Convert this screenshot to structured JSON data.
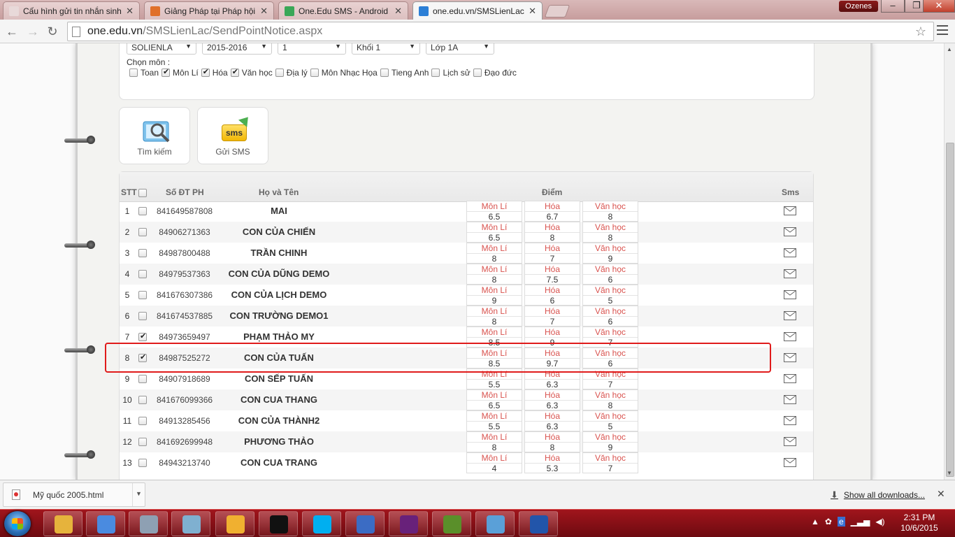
{
  "browser": {
    "tabs": [
      {
        "label": "Cấu hình gửi tin nhắn sinh",
        "icon": "page-icon",
        "color": "#e8d9d9"
      },
      {
        "label": "Giảng Pháp tại Pháp hội q",
        "icon": "lotus-icon",
        "color": "#e0702a"
      },
      {
        "label": "One.Edu SMS - Android A",
        "icon": "play-store-icon",
        "color": "#3aa757"
      },
      {
        "label": "one.edu.vn/SMSLienLac/S",
        "icon": "site-icon",
        "color": "#2c7fd6"
      }
    ],
    "profile": "Ozenes",
    "url_host": "one.edu.vn",
    "url_path": "/SMSLienLac/SendPointNotice.aspx"
  },
  "filters": {
    "selects": [
      "SOLIENLA",
      "2015-2016",
      "1",
      "Khối 1",
      "Lớp 1A"
    ],
    "chon_mon_label": "Chọn môn :",
    "subjects": [
      {
        "label": "Toan",
        "checked": false
      },
      {
        "label": "Môn Lí",
        "checked": true
      },
      {
        "label": "Hóa",
        "checked": true
      },
      {
        "label": "Văn học",
        "checked": true
      },
      {
        "label": "Địa lý",
        "checked": false
      },
      {
        "label": "Môn Nhạc Họa",
        "checked": false
      },
      {
        "label": "Tieng Anh",
        "checked": false
      },
      {
        "label": "Lịch sử",
        "checked": false
      },
      {
        "label": "Đạo đức",
        "checked": false
      }
    ]
  },
  "actions": {
    "search_label": "Tìm kiếm",
    "sms_label": "Gửi SMS",
    "sms_icon_text": "sms"
  },
  "table": {
    "headers": {
      "stt": "STT",
      "phone": "Số ĐT PH",
      "name": "Họ và Tên",
      "score": "Điểm",
      "sms": "Sms"
    },
    "score_subjects": [
      "Môn Lí",
      "Hóa",
      "Văn học"
    ],
    "rows": [
      {
        "stt": "1",
        "checked": false,
        "phone": "841649587808",
        "name": "MAI",
        "scores": [
          "6.5",
          "6.7",
          "8"
        ]
      },
      {
        "stt": "2",
        "checked": false,
        "phone": "84906271363",
        "name": "CON CỦA CHIẾN",
        "scores": [
          "6.5",
          "8",
          "8"
        ]
      },
      {
        "stt": "3",
        "checked": false,
        "phone": "84987800488",
        "name": "TRẦN CHINH",
        "scores": [
          "8",
          "7",
          "9"
        ]
      },
      {
        "stt": "4",
        "checked": false,
        "phone": "84979537363",
        "name": "CON CỦA DŨNG DEMO",
        "scores": [
          "8",
          "7.5",
          "6"
        ]
      },
      {
        "stt": "5",
        "checked": false,
        "phone": "841676307386",
        "name": "CON CỦA LỊCH DEMO",
        "scores": [
          "9",
          "6",
          "5"
        ]
      },
      {
        "stt": "6",
        "checked": false,
        "phone": "841674537885",
        "name": "CON TRƯỜNG DEMO1",
        "scores": [
          "8",
          "7",
          "6"
        ]
      },
      {
        "stt": "7",
        "checked": true,
        "phone": "84973659497",
        "name": "PHẠM THẢO MY",
        "scores": [
          "8.5",
          "9",
          "7"
        ]
      },
      {
        "stt": "8",
        "checked": true,
        "phone": "84987525272",
        "name": "CON CỦA TUẤN",
        "scores": [
          "8.5",
          "9.7",
          "6"
        ]
      },
      {
        "stt": "9",
        "checked": false,
        "phone": "84907918689",
        "name": "CON SẾP TUẤN",
        "scores": [
          "5.5",
          "6.3",
          "7"
        ]
      },
      {
        "stt": "10",
        "checked": false,
        "phone": "841676099366",
        "name": "CON CUA THANG",
        "scores": [
          "6.5",
          "6.3",
          "8"
        ]
      },
      {
        "stt": "11",
        "checked": false,
        "phone": "84913285456",
        "name": "CON CỦA THÀNH2",
        "scores": [
          "5.5",
          "6.3",
          "5"
        ]
      },
      {
        "stt": "12",
        "checked": false,
        "phone": "841692699948",
        "name": "PHƯƠNG THẢO",
        "scores": [
          "8",
          "8",
          "9"
        ]
      },
      {
        "stt": "13",
        "checked": false,
        "phone": "84943213740",
        "name": "CON CUA TRANG",
        "scores": [
          "4",
          "5.3",
          "7"
        ]
      }
    ]
  },
  "downloads": {
    "file": "Mỹ quốc 2005.html",
    "show_all": "Show all downloads..."
  },
  "taskbar": {
    "apps": [
      {
        "name": "explorer-icon",
        "color": "#e6b33c"
      },
      {
        "name": "chrome-icon",
        "color": "#4a8be0"
      },
      {
        "name": "calculator-icon",
        "color": "#8ea0b3"
      },
      {
        "name": "notepad-icon",
        "color": "#7fb0d0"
      },
      {
        "name": "outlook-icon",
        "color": "#f0b030"
      },
      {
        "name": "cmd-icon",
        "color": "#111111"
      },
      {
        "name": "skype-icon",
        "color": "#00aff0"
      },
      {
        "name": "network-icon",
        "color": "#3b6cc4"
      },
      {
        "name": "visual-studio-icon",
        "color": "#68217a"
      },
      {
        "name": "chart-app-icon",
        "color": "#5a8f2a"
      },
      {
        "name": "photo-viewer-icon",
        "color": "#5aa0d8"
      },
      {
        "name": "media-player-icon",
        "color": "#2255aa"
      }
    ],
    "time": "2:31 PM",
    "date": "10/6/2015"
  }
}
